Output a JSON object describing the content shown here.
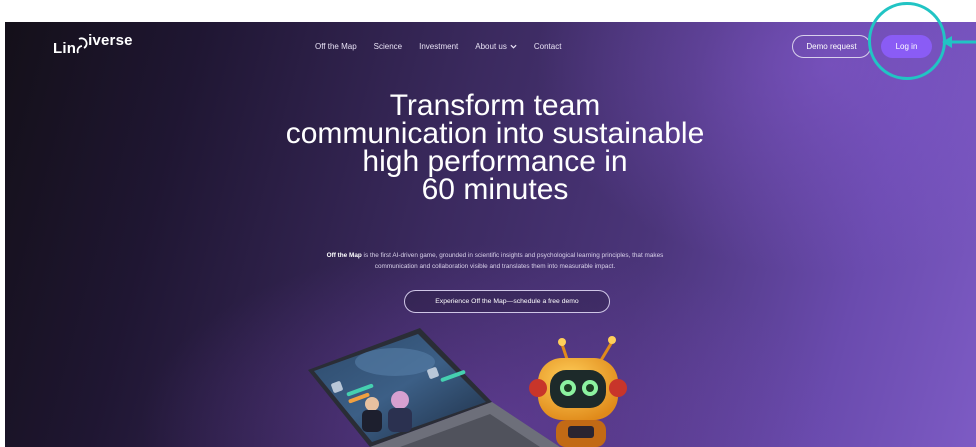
{
  "header": {
    "logo_text": "Lin",
    "logo_superscript": "iverse",
    "nav": [
      {
        "label": "Off the Map"
      },
      {
        "label": "Science"
      },
      {
        "label": "Investment"
      },
      {
        "label": "About us",
        "has_dropdown": true
      },
      {
        "label": "Contact"
      }
    ],
    "demo_request_label": "Demo request",
    "login_label": "Log in"
  },
  "hero": {
    "headline_lines": [
      "Transform team",
      "communication into sustainable",
      "high performance in",
      "60 minutes"
    ],
    "description_bold": "Off the Map",
    "description_line1": " is the first AI-driven game, grounded in scientific insights and psychological learning principles, that makes",
    "description_line2": "communication and collaboration visible and translates them into measurable impact.",
    "cta_label": "Experience Off the Map—schedule a free demo"
  },
  "annotation": {
    "highlight_color": "#21c4c4",
    "target": "login-button"
  },
  "colors": {
    "accent": "#8a5cf5",
    "bg_dark": "#141019",
    "bg_purple": "#7d5bc4"
  }
}
